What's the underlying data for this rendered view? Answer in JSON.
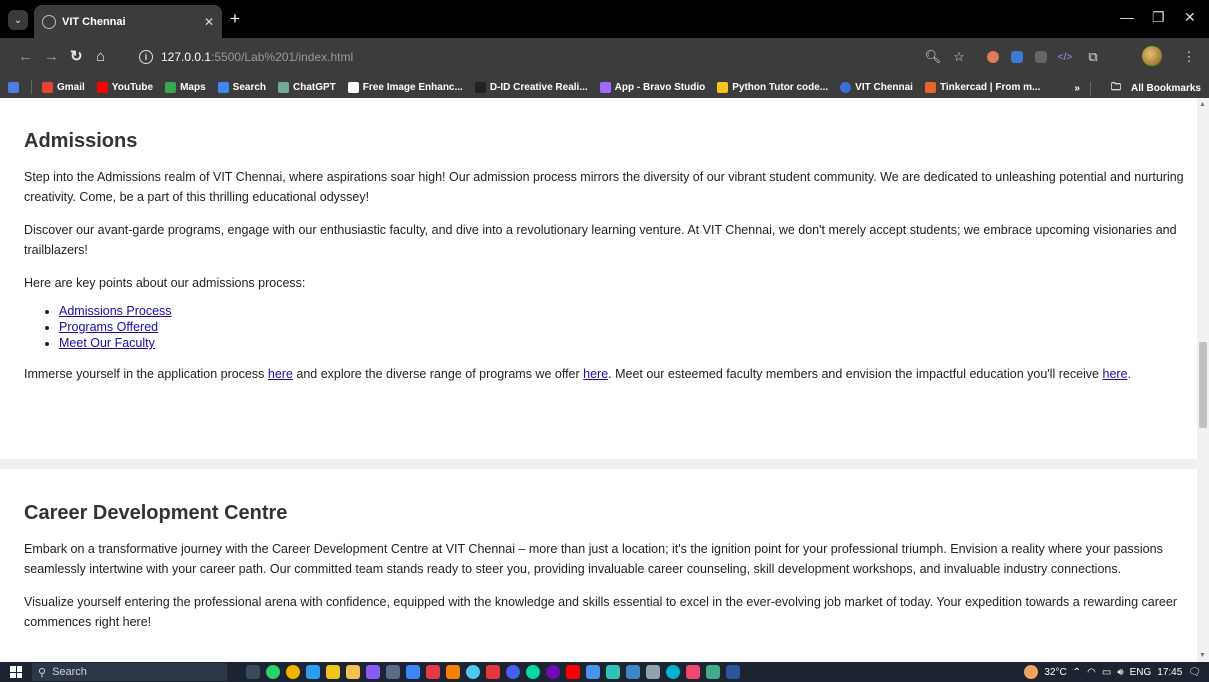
{
  "browser": {
    "tab_title": "VIT Chennai",
    "url_host": "127.0.0.1",
    "url_path": ":5500/Lab%201/index.html",
    "bookmarks": [
      {
        "label": "Gmail",
        "color": "#ea4335"
      },
      {
        "label": "YouTube",
        "color": "#ff0000"
      },
      {
        "label": "Maps",
        "color": "#34a853"
      },
      {
        "label": "Search",
        "color": "#4285f4"
      },
      {
        "label": "ChatGPT",
        "color": "#74aa9c"
      },
      {
        "label": "Free Image Enhanc...",
        "color": "#ffffff"
      },
      {
        "label": "D-ID Creative Reali...",
        "color": "#222222"
      },
      {
        "label": "App - Bravo Studio",
        "color": "#9c6bff"
      },
      {
        "label": "Python Tutor code...",
        "color": "#f5c518"
      },
      {
        "label": "VIT Chennai",
        "color": "#3b6fd8"
      },
      {
        "label": "Tinkercad | From m...",
        "color": "#e8632c"
      }
    ],
    "all_bookmarks": "All Bookmarks"
  },
  "page": {
    "admissions": {
      "title": "Admissions",
      "p1": "Step into the Admissions realm of VIT Chennai, where aspirations soar high! Our admission process mirrors the diversity of our vibrant student community. We are dedicated to unleashing potential and nurturing creativity. Come, be a part of this thrilling educational odyssey!",
      "p2": "Discover our avant-garde programs, engage with our enthusiastic faculty, and dive into a revolutionary learning venture. At VIT Chennai, we don't merely accept students; we embrace upcoming visionaries and trailblazers!",
      "p3": "Here are key points about our admissions process:",
      "links": [
        "Admissions Process",
        "Programs Offered",
        "Meet Our Faculty"
      ],
      "p4_a": "Immerse yourself in the application process",
      "p4_b": "and explore the diverse range of programs we offer",
      "p4_c": ". Meet our esteemed faculty members and envision the impactful education you'll receive",
      "p4_d": ".",
      "here": "here"
    },
    "career": {
      "title": "Career Development Centre",
      "p1": "Embark on a transformative journey with the Career Development Centre at VIT Chennai – more than just a location; it's the ignition point for your professional triumph. Envision a reality where your passions seamlessly intertwine with your career path. Our committed team stands ready to steer you, providing invaluable career counseling, skill development workshops, and invaluable industry connections.",
      "p2": "Visualize yourself entering the professional arena with confidence, equipped with the knowledge and skills essential to excel in the ever-evolving job market of today. Your expedition towards a rewarding career commences right here!"
    }
  },
  "taskbar": {
    "search_placeholder": "Search",
    "temperature": "32°C",
    "language": "ENG",
    "time": "17:45"
  }
}
